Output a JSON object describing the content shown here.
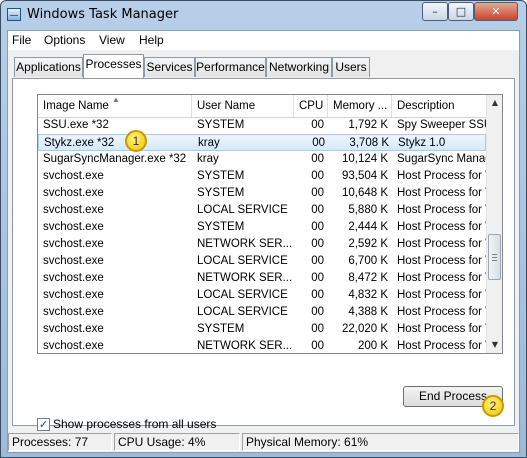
{
  "window": {
    "title": "Windows Task Manager",
    "min": "–",
    "max": "□",
    "close": "✕"
  },
  "menu": [
    "File",
    "Options",
    "View",
    "Help"
  ],
  "tabs": [
    "Applications",
    "Processes",
    "Services",
    "Performance",
    "Networking",
    "Users"
  ],
  "active_tab": "Processes",
  "table": {
    "columns": [
      "Image Name",
      "User Name",
      "CPU",
      "Memory ...",
      "Description"
    ],
    "sort_column": "Image Name",
    "rows": [
      [
        "SSU.exe *32",
        "SYSTEM",
        "00",
        "1,792 K",
        "Spy Sweeper SSU"
      ],
      [
        "Stykz.exe *32",
        "kray",
        "00",
        "3,708 K",
        "Stykz 1.0"
      ],
      [
        "SugarSyncManager.exe *32",
        "kray",
        "00",
        "10,124 K",
        "SugarSync Manage"
      ],
      [
        "svchost.exe",
        "SYSTEM",
        "00",
        "93,504 K",
        "Host Process for W"
      ],
      [
        "svchost.exe",
        "SYSTEM",
        "00",
        "10,648 K",
        "Host Process for W"
      ],
      [
        "svchost.exe",
        "LOCAL SERVICE",
        "00",
        "5,880 K",
        "Host Process for W"
      ],
      [
        "svchost.exe",
        "SYSTEM",
        "00",
        "2,444 K",
        "Host Process for W"
      ],
      [
        "svchost.exe",
        "NETWORK SER...",
        "00",
        "2,592 K",
        "Host Process for W"
      ],
      [
        "svchost.exe",
        "LOCAL SERVICE",
        "00",
        "6,700 K",
        "Host Process for W"
      ],
      [
        "svchost.exe",
        "NETWORK SER...",
        "00",
        "8,472 K",
        "Host Process for W"
      ],
      [
        "svchost.exe",
        "LOCAL SERVICE",
        "00",
        "4,832 K",
        "Host Process for W"
      ],
      [
        "svchost.exe",
        "LOCAL SERVICE",
        "00",
        "4,388 K",
        "Host Process for W"
      ],
      [
        "svchost.exe",
        "SYSTEM",
        "00",
        "22,020 K",
        "Host Process for W"
      ],
      [
        "svchost.exe",
        "NETWORK SER...",
        "00",
        "200 K",
        "Host Process for W"
      ]
    ],
    "selected_row": 1
  },
  "show_all_users": {
    "label": "Show processes from all users",
    "checked": true,
    "mark": "✓"
  },
  "end_process_label": "End Process",
  "callouts": [
    "1",
    "2"
  ],
  "status": {
    "processes": "Processes: 77",
    "cpu": "CPU Usage: 4%",
    "memory": "Physical Memory: 61%"
  },
  "colors": {
    "selection": "#d6e9fb",
    "callout": "#f2c300",
    "title_bar": "#b7cfe8"
  }
}
